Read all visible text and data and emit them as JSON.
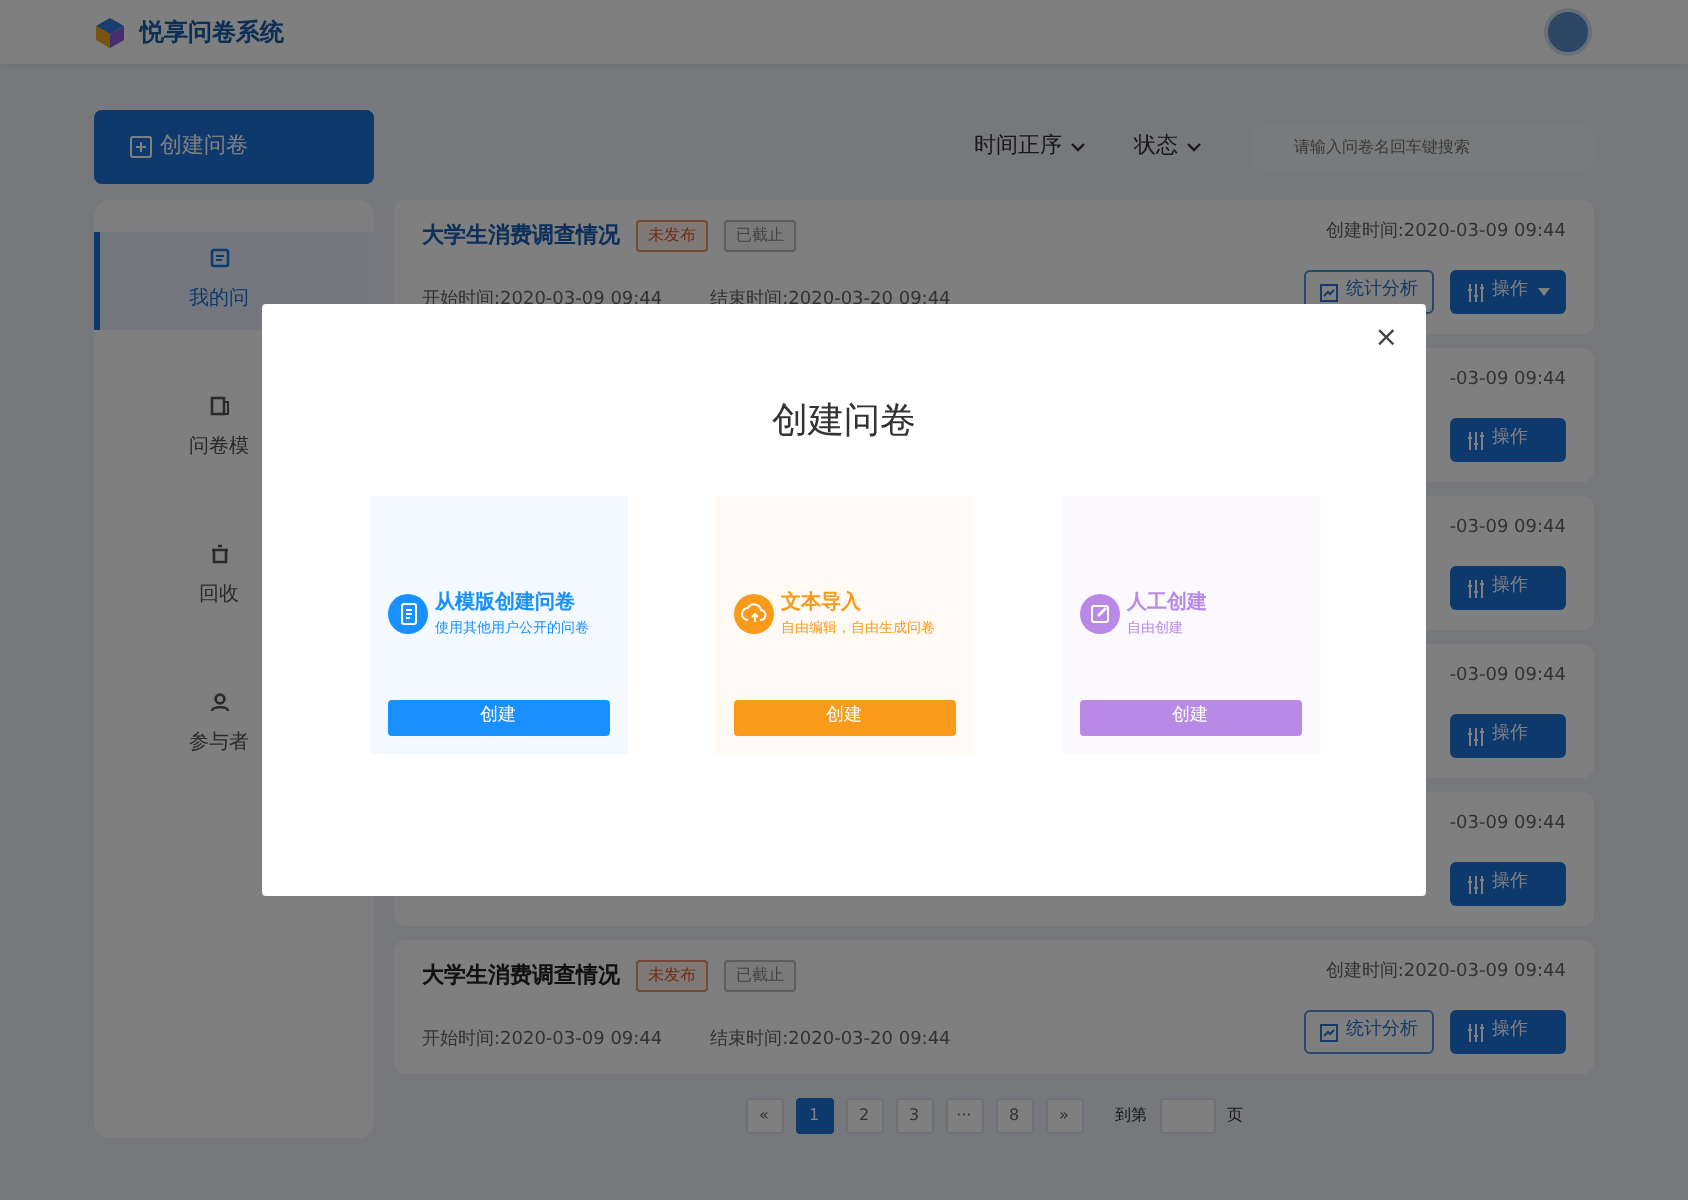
{
  "header": {
    "logo_text": "悦享问卷系统"
  },
  "create_button": {
    "label": "创建问卷"
  },
  "toolbar": {
    "sort": "时间正序",
    "status": "状态",
    "search": {
      "placeholder": "请输入问卷名回车键搜索"
    }
  },
  "sidebar": {
    "items": [
      {
        "label": "我的问",
        "selected": true
      },
      {
        "label": "问卷模",
        "selected": false
      },
      {
        "label": "回收",
        "selected": false
      },
      {
        "label": "参与者",
        "selected": false
      }
    ]
  },
  "surveys": [
    {
      "title": "大学生消费调查情况",
      "badges": [
        {
          "label": "未发布",
          "kind": "unpublished"
        },
        {
          "label": "已截止",
          "kind": "ended"
        }
      ],
      "start": "开始时间:2020-03-09 09:44",
      "end": "结束时间:2020-03-20 09:44",
      "created": "创建时间:2020-03-09 09:44",
      "stats_button": "统计分析",
      "action_button": "操作",
      "dropdown": true
    },
    {
      "created": "-03-09 09:44",
      "action_button": "操作",
      "dropdown": false
    },
    {
      "created": "-03-09 09:44",
      "action_button": "操作",
      "dropdown": false
    },
    {
      "created": "-03-09 09:44",
      "action_button": "操作",
      "dropdown": false
    },
    {
      "created": "-03-09 09:44",
      "action_button": "操作",
      "dropdown": false
    },
    {
      "title": "大学生消费调查情况",
      "badges": [
        {
          "label": "未发布",
          "kind": "unpublished"
        },
        {
          "label": "已截止",
          "kind": "ended"
        }
      ],
      "start": "开始时间:2020-03-09 09:44",
      "end": "结束时间:2020-03-20 09:44",
      "created": "创建时间:2020-03-09 09:44",
      "stats_button": "统计分析",
      "action_button": "操作",
      "dropdown": false
    }
  ],
  "pagination": {
    "prev": "«",
    "pages": [
      {
        "label": "1",
        "selected": true
      },
      {
        "label": "2",
        "selected": false
      },
      {
        "label": "3",
        "selected": false
      },
      {
        "label": "···",
        "selected": false
      },
      {
        "label": "8",
        "selected": false
      }
    ],
    "next": "»",
    "goto_label": "到第",
    "goto_suffix": "页"
  },
  "modal": {
    "title": "创建问卷",
    "close": "×",
    "options": [
      {
        "title": "从模版创建问卷",
        "subtitle": "使用其他用户公开的问卷",
        "button": "创建",
        "color": "#1890ff"
      },
      {
        "title": "文本导入",
        "subtitle": "自由编辑，自由生成问卷",
        "button": "创建",
        "color": "#fa9a1b"
      },
      {
        "title": "人工创建",
        "subtitle": "自由创建",
        "button": "创建",
        "color": "#b88ae6"
      }
    ]
  }
}
